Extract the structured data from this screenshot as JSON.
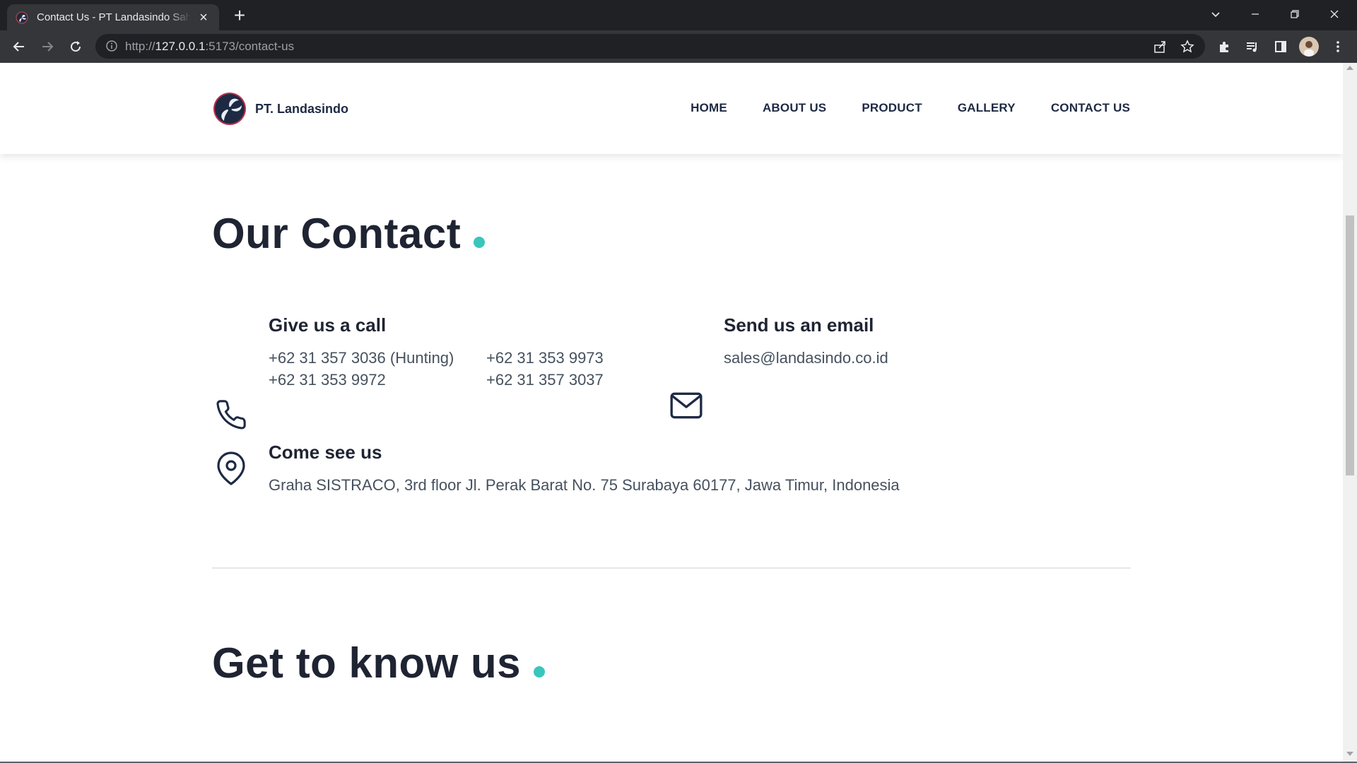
{
  "browser": {
    "tab_title": "Contact Us - PT Landasindo Sahu",
    "url_scheme": "http://",
    "url_host": "127.0.0.1",
    "url_rest": ":5173/contact-us"
  },
  "site": {
    "brand_name": "PT. Landasindo",
    "nav": [
      "HOME",
      "ABOUT US",
      "PRODUCT",
      "GALLERY",
      "CONTACT US"
    ]
  },
  "contact": {
    "title": "Our Contact",
    "call": {
      "heading": "Give us a call",
      "phones": [
        "+62 31 357 3036 (Hunting)",
        "+62 31 353 9973",
        "+62 31 353 9972",
        "+62 31 357 3037"
      ]
    },
    "email": {
      "heading": "Send us an email",
      "address": "sales@landasindo.co.id"
    },
    "visit": {
      "heading": "Come see us",
      "address": "Graha SISTRACO, 3rd floor Jl. Perak Barat No. 75 Surabaya 60177, Jawa Timur, Indonesia"
    }
  },
  "about": {
    "title": "Get to know us"
  },
  "colors": {
    "accent_dot": "#39c6bd",
    "heading": "#1f2433",
    "navy": "#1e2a44"
  }
}
